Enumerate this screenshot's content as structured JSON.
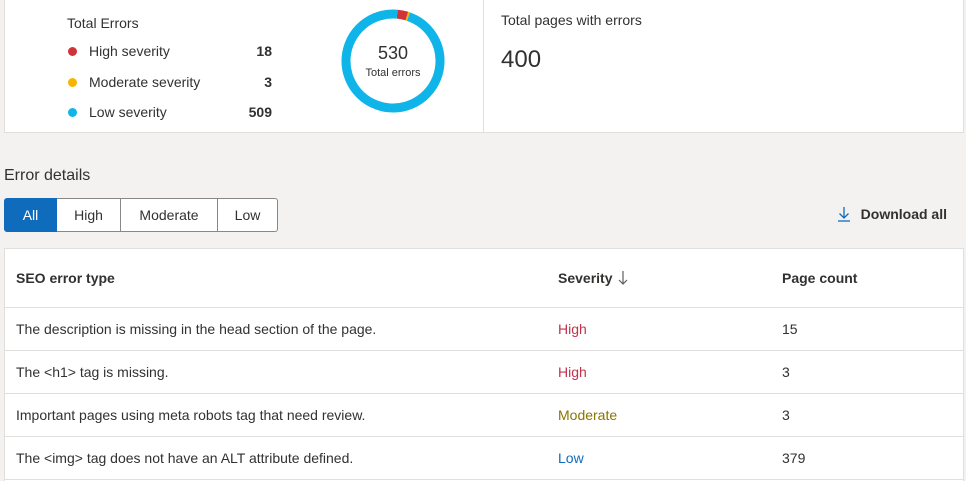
{
  "summary": {
    "legend_title": "Total Errors",
    "items": [
      {
        "label": "High severity",
        "count": "18",
        "color": "#d13438"
      },
      {
        "label": "Moderate severity",
        "count": "3",
        "color": "#f7b500"
      },
      {
        "label": "Low severity",
        "count": "509",
        "color": "#0fb5e8"
      }
    ],
    "donut": {
      "total": "530",
      "caption": "Total errors",
      "high": 18,
      "moderate": 3,
      "low": 509
    },
    "pages_title": "Total pages with errors",
    "pages_value": "400"
  },
  "details": {
    "title": "Error details",
    "filters": [
      "All",
      "High",
      "Moderate",
      "Low"
    ],
    "active_filter": "All",
    "download_label": "Download all",
    "columns": {
      "type": "SEO error type",
      "severity": "Severity",
      "count": "Page count"
    },
    "rows": [
      {
        "type": "The description is missing in the head section of the page.",
        "severity": "High",
        "count": "15"
      },
      {
        "type": "The <h1> tag is missing.",
        "severity": "High",
        "count": "3"
      },
      {
        "type": "Important pages using meta robots tag that need review.",
        "severity": "Moderate",
        "count": "3"
      },
      {
        "type": "The <img> tag does not have an ALT attribute defined.",
        "severity": "Low",
        "count": "379"
      }
    ],
    "severity_colors": {
      "High": "#c4314b",
      "Moderate": "#8a7400",
      "Low": "#0f6cbd"
    }
  }
}
